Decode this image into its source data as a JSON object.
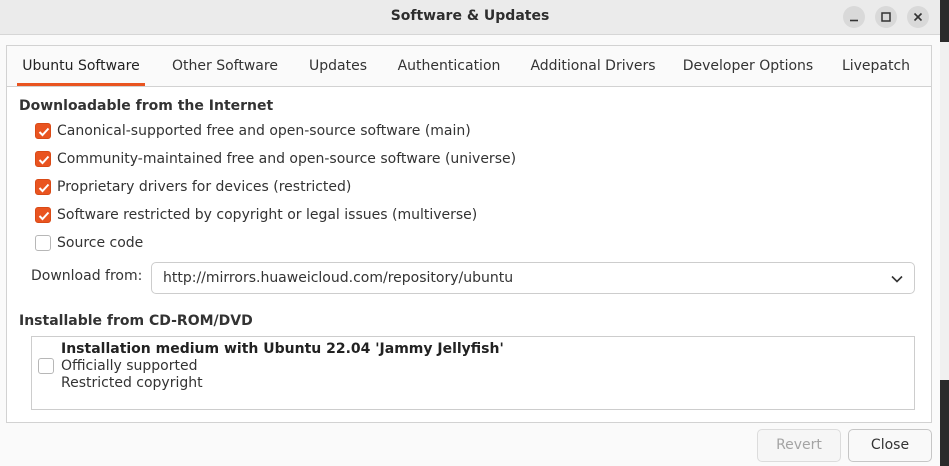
{
  "window": {
    "title": "Software & Updates",
    "controls": [
      "minimize-icon",
      "maximize-icon",
      "close-icon"
    ]
  },
  "tabs": [
    {
      "label": "Ubuntu Software",
      "active": true
    },
    {
      "label": "Other Software",
      "active": false
    },
    {
      "label": "Updates",
      "active": false
    },
    {
      "label": "Authentication",
      "active": false
    },
    {
      "label": "Additional Drivers",
      "active": false
    },
    {
      "label": "Developer Options",
      "active": false
    },
    {
      "label": "Livepatch",
      "active": false
    }
  ],
  "downloadable": {
    "heading": "Downloadable from the Internet",
    "options": [
      {
        "label": "Canonical-supported free and open-source software (main)",
        "checked": true
      },
      {
        "label": "Community-maintained free and open-source software (universe)",
        "checked": true
      },
      {
        "label": "Proprietary drivers for devices (restricted)",
        "checked": true
      },
      {
        "label": "Software restricted by copyright or legal issues (multiverse)",
        "checked": true
      },
      {
        "label": "Source code",
        "checked": false
      }
    ],
    "download_from_label": "Download from:",
    "download_from_value": "http://mirrors.huaweicloud.com/repository/ubuntu"
  },
  "cdrom": {
    "heading": "Installable from CD-ROM/DVD",
    "item": {
      "title": "Installation medium with Ubuntu 22.04 'Jammy Jellyfish'",
      "line1": "Officially supported",
      "line2": "Restricted copyright",
      "checked": false
    }
  },
  "buttons": {
    "revert": "Revert",
    "close": "Close"
  },
  "colors": {
    "accent": "#e95420",
    "titlebar": "#ebebeb",
    "background": "#fafafa"
  }
}
